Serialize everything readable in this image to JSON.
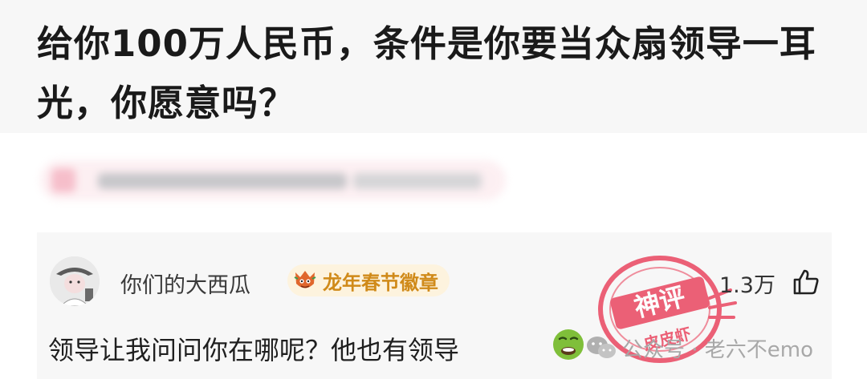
{
  "question": {
    "title": "给你100万人民币，条件是你要当众扇领导一耳光，你愿意吗？"
  },
  "comment": {
    "username": "你们的大西瓜",
    "badge": {
      "label": "龙年春节徽章",
      "icon": "dragon-badge-icon"
    },
    "likes": "1.3万",
    "text": "领导让我问问你在哪呢？他也有领导",
    "emoji": "nauseated-face-emoji"
  },
  "stamp": {
    "line1": "神评",
    "line2": "皮皮虾",
    "color": "#e94660"
  },
  "watermark": {
    "text": "公众号 · 老六不emo",
    "icon": "wechat-icon"
  },
  "colors": {
    "badge_text": "#d08a19",
    "badge_bg": "#fdf3de",
    "card_bg": "#f7f7f7"
  }
}
